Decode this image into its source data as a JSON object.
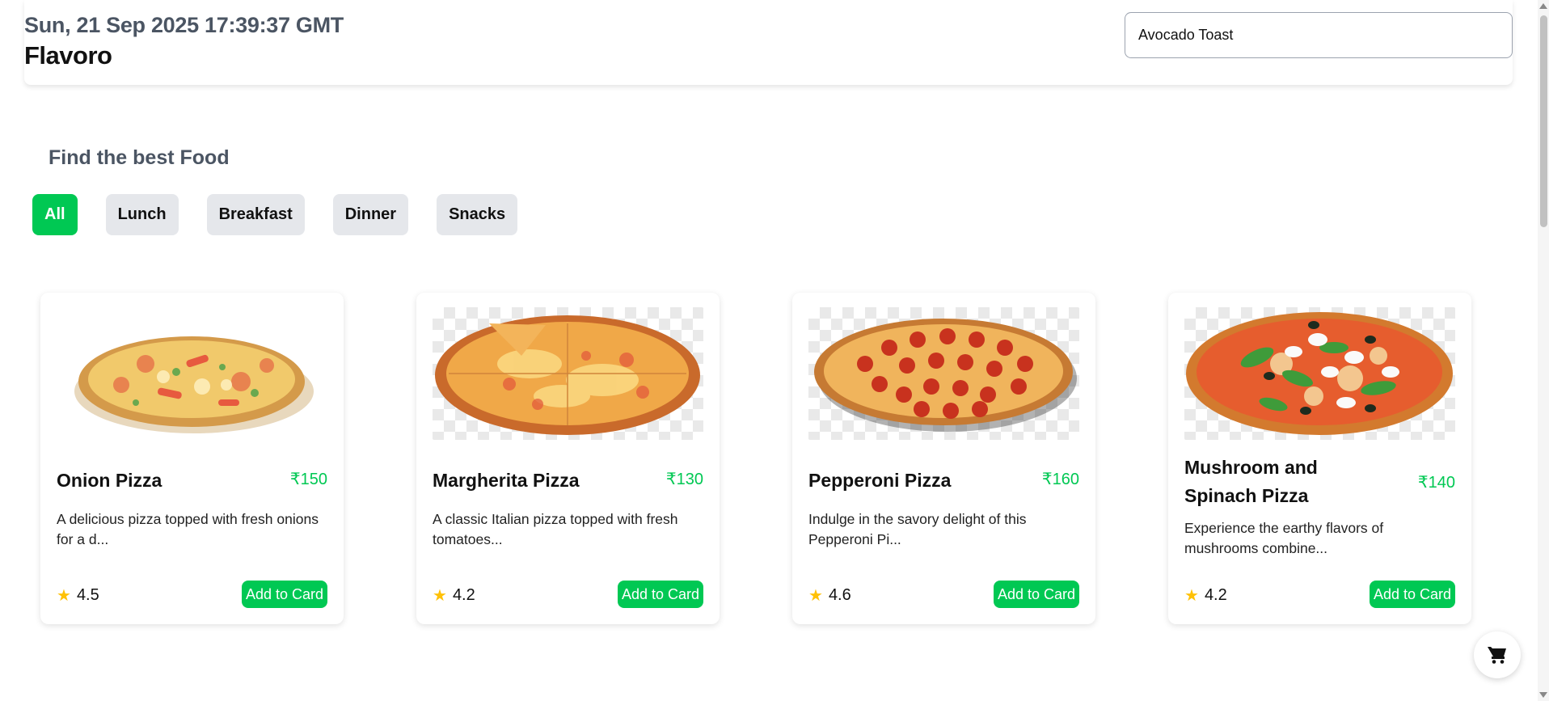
{
  "header": {
    "datetime": "Sun, 21 Sep 2025 17:39:37 GMT",
    "brand": "Flavoro",
    "search_value": "Avocado Toast"
  },
  "section": {
    "title": "Find the best Food"
  },
  "filters": [
    {
      "label": "All",
      "active": true
    },
    {
      "label": "Lunch",
      "active": false
    },
    {
      "label": "Breakfast",
      "active": false
    },
    {
      "label": "Dinner",
      "active": false
    },
    {
      "label": "Snacks",
      "active": false
    }
  ],
  "cards": [
    {
      "name": "Onion Pizza",
      "price": "₹150",
      "description": "A delicious pizza topped with fresh onions for a d...",
      "rating": "4.5",
      "button": "Add to Card"
    },
    {
      "name": "Margherita Pizza",
      "price": "₹130",
      "description": "A classic Italian pizza topped with fresh tomatoes...",
      "rating": "4.2",
      "button": "Add to Card"
    },
    {
      "name": "Pepperoni Pizza",
      "price": "₹160",
      "description": "Indulge in the savory delight of this Pepperoni Pi...",
      "rating": "4.6",
      "button": "Add to Card"
    },
    {
      "name": "Mushroom and Spinach Pizza",
      "price": "₹140",
      "description": "Experience the earthy flavors of mushrooms combine...",
      "rating": "4.2",
      "button": "Add to Card"
    }
  ],
  "icons": {
    "star": "star-icon",
    "cart": "cart-icon"
  },
  "colors": {
    "accent": "#00c853",
    "star": "#ffc107",
    "chip_bg": "#e5e7eb"
  }
}
